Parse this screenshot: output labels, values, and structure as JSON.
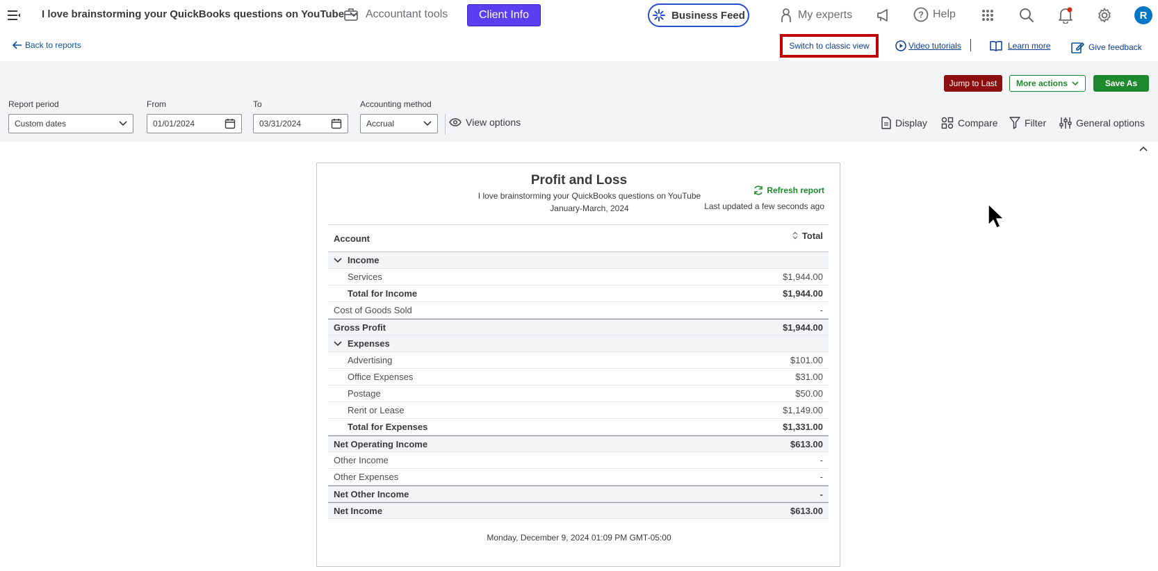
{
  "topnav": {
    "company_name": "I love brainstorming your QuickBooks questions on YouTube",
    "accountant_tools": "Accountant tools",
    "client_info": "Client Info",
    "business_feed": "Business Feed",
    "my_experts": "My experts",
    "help": "Help",
    "avatar_initial": "R"
  },
  "subheader": {
    "back_to_reports": "Back to reports",
    "switch_classic": "Switch to classic view",
    "video_tutorials": "Video tutorials",
    "learn_more": "Learn more",
    "give_feedback": "Give feedback"
  },
  "actions": {
    "jump_to_last": "Jump to Last",
    "more_actions": "More actions",
    "save_as": "Save As"
  },
  "filters": {
    "report_period_label": "Report period",
    "report_period_value": "Custom dates",
    "from_label": "From",
    "from_value": "01/01/2024",
    "to_label": "To",
    "to_value": "03/31/2024",
    "method_label": "Accounting method",
    "method_value": "Accrual",
    "view_options": "View options"
  },
  "tools": {
    "display": "Display",
    "compare": "Compare",
    "filter": "Filter",
    "general_options": "General options"
  },
  "report": {
    "title": "Profit and Loss",
    "company": "I love brainstorming your QuickBooks questions on YouTube",
    "period": "January-March, 2024",
    "refresh": "Refresh report",
    "updated": "Last updated a few seconds ago",
    "col_account": "Account",
    "col_total": "Total",
    "rows": [
      {
        "kind": "sect",
        "label": "Income",
        "value": ""
      },
      {
        "kind": "item",
        "label": "Services",
        "value": "$1,944.00"
      },
      {
        "kind": "total",
        "label": "Total for Income",
        "value": "$1,944.00"
      },
      {
        "kind": "plain",
        "label": "Cost of Goods Sold",
        "value": "-"
      },
      {
        "kind": "summary",
        "label": "Gross Profit",
        "value": "$1,944.00"
      },
      {
        "kind": "sect",
        "label": "Expenses",
        "value": ""
      },
      {
        "kind": "item",
        "label": "Advertising",
        "value": "$101.00"
      },
      {
        "kind": "item",
        "label": "Office Expenses",
        "value": "$31.00"
      },
      {
        "kind": "item",
        "label": "Postage",
        "value": "$50.00"
      },
      {
        "kind": "item",
        "label": "Rent or Lease",
        "value": "$1,149.00"
      },
      {
        "kind": "total",
        "label": "Total for Expenses",
        "value": "$1,331.00"
      },
      {
        "kind": "summary",
        "label": "Net Operating Income",
        "value": "$613.00"
      },
      {
        "kind": "plain",
        "label": "Other Income",
        "value": "-"
      },
      {
        "kind": "plain",
        "label": "Other Expenses",
        "value": "-"
      },
      {
        "kind": "summary",
        "label": "Net Other Income",
        "value": "-"
      },
      {
        "kind": "summary",
        "label": "Net Income",
        "value": "$613.00"
      }
    ],
    "footer": "Monday, December 9, 2024 01:09 PM GMT-05:00"
  }
}
